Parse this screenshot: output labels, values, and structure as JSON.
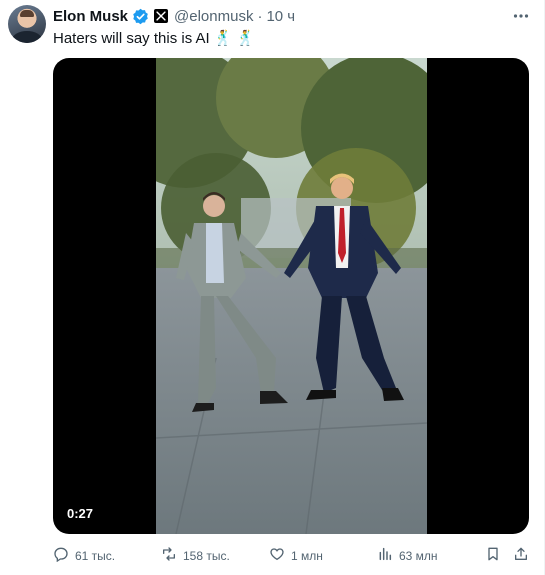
{
  "tweet": {
    "author": {
      "display_name": "Elon Musk",
      "handle": "@elonmusk",
      "separator": "·",
      "time": "10 ч",
      "verified_color": "#1d9bf0"
    },
    "text": "Haters will say this is AI",
    "emojis": [
      "🕺",
      "🕺"
    ],
    "media": {
      "type": "video",
      "duration": "0:27"
    },
    "stats": {
      "replies": "61 тыс.",
      "reposts": "158 тыс.",
      "likes": "1 млн",
      "views": "63 млн"
    },
    "icons": {
      "reply": "reply-icon",
      "repost": "repost-icon",
      "like": "heart-icon",
      "views": "views-icon",
      "bookmark": "bookmark-icon",
      "share": "share-icon",
      "more": "more-icon"
    }
  }
}
